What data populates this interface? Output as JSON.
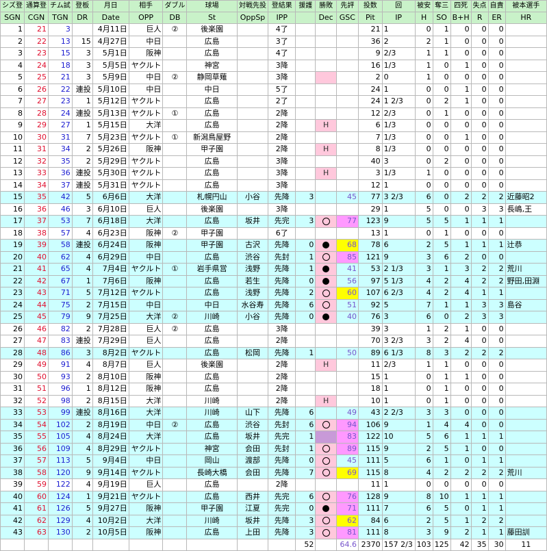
{
  "header_jp": [
    "シズ登",
    "通算登",
    "チム試",
    "登板",
    "月日",
    "相手",
    "ダブル",
    "球場",
    "対戦先投",
    "登結果",
    "援護",
    "勝敗",
    "先評",
    "投数",
    "回",
    "被安",
    "奪三",
    "四死",
    "失点",
    "自責",
    "被本選手"
  ],
  "header_en": [
    "SGN",
    "CGN",
    "TGN",
    "DR",
    "Date",
    "OPP",
    "DB",
    "St",
    "OppSp",
    "IPP",
    "",
    "Dec",
    "GSC",
    "Pit",
    "IP",
    "H",
    "SO",
    "B+H",
    "R",
    "ER",
    "HR"
  ],
  "rows": [
    {
      "sgn": "1",
      "cgn": "21",
      "tgn": "3",
      "dr": "",
      "date": "4月11日",
      "opp": "巨人",
      "db": "②",
      "st": "後楽園",
      "oppsp": "",
      "ipp": "4了",
      "run": "",
      "dec": "",
      "gsc": "",
      "pit": "21",
      "ip": "1",
      "h": "0",
      "so": "1",
      "bh": "0",
      "r": "0",
      "er": "0",
      "hr": ""
    },
    {
      "sgn": "2",
      "cgn": "22",
      "tgn": "13",
      "dr": "15",
      "date": "4月27日",
      "opp": "中日",
      "db": "",
      "st": "広島",
      "oppsp": "",
      "ipp": "3了",
      "run": "",
      "dec": "",
      "gsc": "",
      "pit": "36",
      "ip": "2",
      "h": "2",
      "so": "1",
      "bh": "0",
      "r": "0",
      "er": "0",
      "hr": ""
    },
    {
      "sgn": "3",
      "cgn": "23",
      "tgn": "15",
      "dr": "3",
      "date": "5月1日",
      "opp": "阪神",
      "db": "",
      "st": "広島",
      "oppsp": "",
      "ipp": "4了",
      "run": "",
      "dec": "",
      "gsc": "",
      "pit": "9",
      "ip": "2/3",
      "h": "1",
      "so": "1",
      "bh": "0",
      "r": "0",
      "er": "0",
      "hr": ""
    },
    {
      "sgn": "4",
      "cgn": "24",
      "tgn": "18",
      "dr": "3",
      "date": "5月5日",
      "opp": "ヤクルト",
      "db": "",
      "st": "神宮",
      "oppsp": "",
      "ipp": "3降",
      "run": "",
      "dec": "",
      "gsc": "",
      "pit": "16",
      "ip": "1/3",
      "h": "1",
      "so": "0",
      "bh": "1",
      "r": "0",
      "er": "0",
      "hr": ""
    },
    {
      "sgn": "5",
      "cgn": "25",
      "tgn": "21",
      "dr": "3",
      "date": "5月9日",
      "opp": "中日",
      "db": "②",
      "st": "静岡草薙",
      "oppsp": "",
      "ipp": "3降",
      "run": "",
      "dec": "",
      "gsc": "",
      "pit": "2",
      "ip": "0",
      "h": "1",
      "so": "0",
      "bh": "0",
      "r": "0",
      "er": "0",
      "hr": ""
    },
    {
      "sgn": "6",
      "cgn": "26",
      "tgn": "22",
      "dr": "連投",
      "date": "5月10日",
      "opp": "中日",
      "db": "",
      "st": "中日",
      "oppsp": "",
      "ipp": "5了",
      "run": "",
      "dec": "",
      "gsc": "",
      "pit": "24",
      "ip": "1",
      "h": "0",
      "so": "0",
      "bh": "1",
      "r": "0",
      "er": "0",
      "hr": ""
    },
    {
      "sgn": "7",
      "cgn": "27",
      "tgn": "23",
      "dr": "1",
      "date": "5月12日",
      "opp": "ヤクルト",
      "db": "",
      "st": "広島",
      "oppsp": "",
      "ipp": "2了",
      "run": "",
      "dec": "",
      "gsc": "",
      "pit": "24",
      "ip": "1 2/3",
      "h": "0",
      "so": "2",
      "bh": "1",
      "r": "0",
      "er": "0",
      "hr": ""
    },
    {
      "sgn": "8",
      "cgn": "28",
      "tgn": "24",
      "dr": "連投",
      "date": "5月13日",
      "opp": "ヤクルト",
      "db": "①",
      "st": "広島",
      "oppsp": "",
      "ipp": "2降",
      "run": "",
      "dec": "",
      "gsc": "",
      "pit": "12",
      "ip": "2/3",
      "h": "0",
      "so": "1",
      "bh": "0",
      "r": "0",
      "er": "0",
      "hr": ""
    },
    {
      "sgn": "9",
      "cgn": "29",
      "tgn": "27",
      "dr": "1",
      "date": "5月15日",
      "opp": "大洋",
      "db": "",
      "st": "広島",
      "oppsp": "",
      "ipp": "2降",
      "run": "",
      "dec": "H",
      "gsc": "",
      "pit": "6",
      "ip": "1/3",
      "h": "0",
      "so": "0",
      "bh": "0",
      "r": "0",
      "er": "0",
      "hr": ""
    },
    {
      "sgn": "10",
      "cgn": "30",
      "tgn": "31",
      "dr": "7",
      "date": "5月23日",
      "opp": "ヤクルト",
      "db": "①",
      "st": "新潟鳥屋野",
      "oppsp": "",
      "ipp": "2降",
      "run": "",
      "dec": "",
      "gsc": "",
      "pit": "7",
      "ip": "1/3",
      "h": "0",
      "so": "0",
      "bh": "1",
      "r": "0",
      "er": "0",
      "hr": ""
    },
    {
      "sgn": "11",
      "cgn": "31",
      "tgn": "34",
      "dr": "2",
      "date": "5月26日",
      "opp": "阪神",
      "db": "",
      "st": "甲子園",
      "oppsp": "",
      "ipp": "2降",
      "run": "",
      "dec": "H",
      "gsc": "",
      "pit": "8",
      "ip": "1/3",
      "h": "0",
      "so": "0",
      "bh": "0",
      "r": "0",
      "er": "0",
      "hr": ""
    },
    {
      "sgn": "12",
      "cgn": "32",
      "tgn": "35",
      "dr": "2",
      "date": "5月29日",
      "opp": "ヤクルト",
      "db": "",
      "st": "広島",
      "oppsp": "",
      "ipp": "3降",
      "run": "",
      "dec": "",
      "gsc": "",
      "pit": "40",
      "ip": "3",
      "h": "0",
      "so": "2",
      "bh": "0",
      "r": "0",
      "er": "0",
      "hr": ""
    },
    {
      "sgn": "13",
      "cgn": "33",
      "tgn": "36",
      "dr": "連投",
      "date": "5月30日",
      "opp": "ヤクルト",
      "db": "",
      "st": "広島",
      "oppsp": "",
      "ipp": "3降",
      "run": "",
      "dec": "H",
      "gsc": "",
      "pit": "3",
      "ip": "1/3",
      "h": "1",
      "so": "0",
      "bh": "0",
      "r": "0",
      "er": "0",
      "hr": ""
    },
    {
      "sgn": "14",
      "cgn": "34",
      "tgn": "37",
      "dr": "連投",
      "date": "5月31日",
      "opp": "ヤクルト",
      "db": "",
      "st": "広島",
      "oppsp": "",
      "ipp": "3降",
      "run": "",
      "dec": "",
      "gsc": "",
      "pit": "12",
      "ip": "1",
      "h": "0",
      "so": "0",
      "bh": "0",
      "r": "0",
      "er": "0",
      "hr": ""
    },
    {
      "sgn": "15",
      "cgn": "35",
      "tgn": "42",
      "dr": "5",
      "date": "6月6日",
      "opp": "大洋",
      "db": "",
      "st": "札幌円山",
      "oppsp": "小谷",
      "ipp": "先降",
      "run": "3",
      "dec": "",
      "gsc": "45",
      "pit": "77",
      "ip": "3 2/3",
      "h": "6",
      "so": "0",
      "bh": "2",
      "r": "2",
      "er": "2",
      "hr": "近藤昭2"
    },
    {
      "sgn": "16",
      "cgn": "36",
      "tgn": "46",
      "dr": "3",
      "date": "6月10日",
      "opp": "巨人",
      "db": "",
      "st": "後楽園",
      "oppsp": "",
      "ipp": "3降",
      "run": "",
      "dec": "",
      "gsc": "",
      "pit": "29",
      "ip": "1",
      "h": "5",
      "so": "0",
      "bh": "0",
      "r": "3",
      "er": "3",
      "hr": "長嶋,王"
    },
    {
      "sgn": "17",
      "cgn": "37",
      "tgn": "53",
      "dr": "7",
      "date": "6月18日",
      "opp": "大洋",
      "db": "",
      "st": "広島",
      "oppsp": "坂井",
      "ipp": "先完",
      "run": "3",
      "dec": "○",
      "gsc": "77",
      "pit": "123",
      "ip": "9",
      "h": "5",
      "so": "5",
      "bh": "1",
      "r": "1",
      "er": "1",
      "hr": ""
    },
    {
      "sgn": "18",
      "cgn": "38",
      "tgn": "57",
      "dr": "4",
      "date": "6月23日",
      "opp": "阪神",
      "db": "②",
      "st": "甲子園",
      "oppsp": "",
      "ipp": "6了",
      "run": "",
      "dec": "",
      "gsc": "",
      "pit": "13",
      "ip": "1",
      "h": "0",
      "so": "1",
      "bh": "0",
      "r": "0",
      "er": "0",
      "hr": ""
    },
    {
      "sgn": "19",
      "cgn": "39",
      "tgn": "58",
      "dr": "連投",
      "date": "6月24日",
      "opp": "阪神",
      "db": "",
      "st": "甲子園",
      "oppsp": "古沢",
      "ipp": "先降",
      "run": "0",
      "dec": "●",
      "gsc": "68",
      "pit": "78",
      "ip": "6",
      "h": "2",
      "so": "5",
      "bh": "1",
      "r": "1",
      "er": "1",
      "hr": "辻恭"
    },
    {
      "sgn": "20",
      "cgn": "40",
      "tgn": "62",
      "dr": "4",
      "date": "6月29日",
      "opp": "中日",
      "db": "",
      "st": "広島",
      "oppsp": "渋谷",
      "ipp": "先封",
      "run": "1",
      "dec": "○",
      "gsc": "85",
      "pit": "121",
      "ip": "9",
      "h": "3",
      "so": "6",
      "bh": "2",
      "r": "0",
      "er": "0",
      "hr": ""
    },
    {
      "sgn": "21",
      "cgn": "41",
      "tgn": "65",
      "dr": "4",
      "date": "7月4日",
      "opp": "ヤクルト",
      "db": "①",
      "st": "岩手県営",
      "oppsp": "浅野",
      "ipp": "先降",
      "run": "1",
      "dec": "●",
      "gsc": "41",
      "pit": "53",
      "ip": "2 1/3",
      "h": "3",
      "so": "1",
      "bh": "3",
      "r": "2",
      "er": "2",
      "hr": "荒川"
    },
    {
      "sgn": "22",
      "cgn": "42",
      "tgn": "67",
      "dr": "1",
      "date": "7月6日",
      "opp": "阪神",
      "db": "",
      "st": "広島",
      "oppsp": "若生",
      "ipp": "先降",
      "run": "0",
      "dec": "●",
      "gsc": "56",
      "pit": "97",
      "ip": "5 1/3",
      "h": "4",
      "so": "2",
      "bh": "4",
      "r": "2",
      "er": "2",
      "hr": "野田,田淵"
    },
    {
      "sgn": "23",
      "cgn": "43",
      "tgn": "71",
      "dr": "5",
      "date": "7月12日",
      "opp": "ヤクルト",
      "db": "",
      "st": "広島",
      "oppsp": "浅野",
      "ipp": "先降",
      "run": "2",
      "dec": "○",
      "gsc": "60",
      "pit": "107",
      "ip": "6 2/3",
      "h": "4",
      "so": "2",
      "bh": "4",
      "r": "1",
      "er": "1",
      "hr": ""
    },
    {
      "sgn": "24",
      "cgn": "44",
      "tgn": "75",
      "dr": "2",
      "date": "7月15日",
      "opp": "中日",
      "db": "",
      "st": "中日",
      "oppsp": "水谷寿",
      "ipp": "先降",
      "run": "6",
      "dec": "○",
      "gsc": "51",
      "pit": "92",
      "ip": "5",
      "h": "7",
      "so": "1",
      "bh": "1",
      "r": "3",
      "er": "3",
      "hr": "島谷"
    },
    {
      "sgn": "25",
      "cgn": "45",
      "tgn": "79",
      "dr": "9",
      "date": "7月25日",
      "opp": "大洋",
      "db": "②",
      "st": "川崎",
      "oppsp": "小谷",
      "ipp": "先降",
      "run": "0",
      "dec": "●",
      "gsc": "40",
      "pit": "76",
      "ip": "3",
      "h": "6",
      "so": "0",
      "bh": "2",
      "r": "3",
      "er": "3",
      "hr": ""
    },
    {
      "sgn": "26",
      "cgn": "46",
      "tgn": "82",
      "dr": "2",
      "date": "7月28日",
      "opp": "巨人",
      "db": "②",
      "st": "広島",
      "oppsp": "",
      "ipp": "3降",
      "run": "",
      "dec": "",
      "gsc": "",
      "pit": "39",
      "ip": "3",
      "h": "1",
      "so": "2",
      "bh": "1",
      "r": "0",
      "er": "0",
      "hr": ""
    },
    {
      "sgn": "27",
      "cgn": "47",
      "tgn": "83",
      "dr": "連投",
      "date": "7月29日",
      "opp": "巨人",
      "db": "",
      "st": "広島",
      "oppsp": "",
      "ipp": "2降",
      "run": "",
      "dec": "",
      "gsc": "",
      "pit": "70",
      "ip": "3 2/3",
      "h": "3",
      "so": "2",
      "bh": "4",
      "r": "0",
      "er": "0",
      "hr": ""
    },
    {
      "sgn": "28",
      "cgn": "48",
      "tgn": "86",
      "dr": "3",
      "date": "8月2日",
      "opp": "ヤクルト",
      "db": "",
      "st": "広島",
      "oppsp": "松岡",
      "ipp": "先降",
      "run": "1",
      "dec": "",
      "gsc": "50",
      "pit": "89",
      "ip": "6 1/3",
      "h": "8",
      "so": "3",
      "bh": "2",
      "r": "2",
      "er": "2",
      "hr": ""
    },
    {
      "sgn": "29",
      "cgn": "49",
      "tgn": "91",
      "dr": "4",
      "date": "8月7日",
      "opp": "巨人",
      "db": "",
      "st": "後楽園",
      "oppsp": "",
      "ipp": "2降",
      "run": "",
      "dec": "H",
      "gsc": "",
      "pit": "11",
      "ip": "2/3",
      "h": "1",
      "so": "1",
      "bh": "0",
      "r": "0",
      "er": "0",
      "hr": ""
    },
    {
      "sgn": "30",
      "cgn": "50",
      "tgn": "93",
      "dr": "2",
      "date": "8月10日",
      "opp": "阪神",
      "db": "",
      "st": "広島",
      "oppsp": "",
      "ipp": "2降",
      "run": "",
      "dec": "",
      "gsc": "",
      "pit": "15",
      "ip": "1",
      "h": "0",
      "so": "1",
      "bh": "1",
      "r": "0",
      "er": "0",
      "hr": ""
    },
    {
      "sgn": "31",
      "cgn": "51",
      "tgn": "96",
      "dr": "1",
      "date": "8月12日",
      "opp": "阪神",
      "db": "",
      "st": "広島",
      "oppsp": "",
      "ipp": "2降",
      "run": "",
      "dec": "",
      "gsc": "",
      "pit": "18",
      "ip": "1",
      "h": "0",
      "so": "1",
      "bh": "0",
      "r": "0",
      "er": "0",
      "hr": ""
    },
    {
      "sgn": "32",
      "cgn": "52",
      "tgn": "98",
      "dr": "2",
      "date": "8月15日",
      "opp": "大洋",
      "db": "",
      "st": "川崎",
      "oppsp": "",
      "ipp": "2降",
      "run": "",
      "dec": "H",
      "gsc": "",
      "pit": "10",
      "ip": "1",
      "h": "0",
      "so": "1",
      "bh": "0",
      "r": "0",
      "er": "0",
      "hr": ""
    },
    {
      "sgn": "33",
      "cgn": "53",
      "tgn": "99",
      "dr": "連投",
      "date": "8月16日",
      "opp": "大洋",
      "db": "",
      "st": "川崎",
      "oppsp": "山下",
      "ipp": "先降",
      "run": "6",
      "dec": "",
      "gsc": "49",
      "pit": "43",
      "ip": "2 2/3",
      "h": "3",
      "so": "3",
      "bh": "0",
      "r": "0",
      "er": "0",
      "hr": ""
    },
    {
      "sgn": "34",
      "cgn": "54",
      "tgn": "102",
      "dr": "2",
      "date": "8月19日",
      "opp": "中日",
      "db": "②",
      "st": "広島",
      "oppsp": "渋谷",
      "ipp": "先封",
      "run": "6",
      "dec": "○",
      "gsc": "94",
      "pit": "106",
      "ip": "9",
      "h": "1",
      "so": "4",
      "bh": "4",
      "r": "0",
      "er": "0",
      "hr": ""
    },
    {
      "sgn": "35",
      "cgn": "55",
      "tgn": "105",
      "dr": "4",
      "date": "8月24日",
      "opp": "大洋",
      "db": "",
      "st": "広島",
      "oppsp": "坂井",
      "ipp": "先完",
      "run": "1",
      "dec": "",
      "gsc": "83",
      "pit": "122",
      "ip": "10",
      "h": "5",
      "so": "6",
      "bh": "1",
      "r": "1",
      "er": "1",
      "hr": ""
    },
    {
      "sgn": "36",
      "cgn": "56",
      "tgn": "109",
      "dr": "4",
      "date": "8月29日",
      "opp": "ヤクルト",
      "db": "",
      "st": "神宮",
      "oppsp": "会田",
      "ipp": "先封",
      "run": "1",
      "dec": "○",
      "gsc": "89",
      "pit": "115",
      "ip": "9",
      "h": "2",
      "so": "5",
      "bh": "1",
      "r": "0",
      "er": "0",
      "hr": ""
    },
    {
      "sgn": "37",
      "cgn": "57",
      "tgn": "113",
      "dr": "5",
      "date": "9月4日",
      "opp": "中日",
      "db": "",
      "st": "岡山",
      "oppsp": "渡部",
      "ipp": "先降",
      "run": "0",
      "dec": "○",
      "gsc": "45",
      "pit": "111",
      "ip": "5",
      "h": "6",
      "so": "1",
      "bh": "0",
      "r": "1",
      "er": "1",
      "hr": ""
    },
    {
      "sgn": "38",
      "cgn": "58",
      "tgn": "120",
      "dr": "9",
      "date": "9月14日",
      "opp": "ヤクルト",
      "db": "",
      "st": "長崎大橋",
      "oppsp": "会田",
      "ipp": "先降",
      "run": "7",
      "dec": "○",
      "gsc": "69",
      "pit": "115",
      "ip": "8",
      "h": "4",
      "so": "2",
      "bh": "2",
      "r": "2",
      "er": "2",
      "hr": "荒川"
    },
    {
      "sgn": "39",
      "cgn": "59",
      "tgn": "122",
      "dr": "4",
      "date": "9月19日",
      "opp": "巨人",
      "db": "",
      "st": "広島",
      "oppsp": "",
      "ipp": "2降",
      "run": "",
      "dec": "",
      "gsc": "",
      "pit": "11",
      "ip": "1",
      "h": "0",
      "so": "0",
      "bh": "0",
      "r": "0",
      "er": "0",
      "hr": ""
    },
    {
      "sgn": "40",
      "cgn": "60",
      "tgn": "124",
      "dr": "1",
      "date": "9月21日",
      "opp": "ヤクルト",
      "db": "",
      "st": "広島",
      "oppsp": "西井",
      "ipp": "先完",
      "run": "6",
      "dec": "○",
      "gsc": "76",
      "pit": "128",
      "ip": "9",
      "h": "8",
      "so": "10",
      "bh": "1",
      "r": "1",
      "er": "1",
      "hr": ""
    },
    {
      "sgn": "41",
      "cgn": "61",
      "tgn": "126",
      "dr": "5",
      "date": "9月27日",
      "opp": "阪神",
      "db": "",
      "st": "甲子園",
      "oppsp": "江夏",
      "ipp": "先完",
      "run": "0",
      "dec": "●",
      "gsc": "71",
      "pit": "111",
      "ip": "7",
      "h": "6",
      "so": "5",
      "bh": "0",
      "r": "1",
      "er": "1",
      "hr": ""
    },
    {
      "sgn": "42",
      "cgn": "62",
      "tgn": "129",
      "dr": "4",
      "date": "10月2日",
      "opp": "大洋",
      "db": "",
      "st": "川崎",
      "oppsp": "坂井",
      "ipp": "先降",
      "run": "3",
      "dec": "○",
      "gsc": "62",
      "pit": "84",
      "ip": "6",
      "h": "2",
      "so": "5",
      "bh": "1",
      "r": "2",
      "er": "2",
      "hr": ""
    },
    {
      "sgn": "43",
      "cgn": "63",
      "tgn": "130",
      "dr": "2",
      "date": "10月5日",
      "opp": "阪神",
      "db": "",
      "st": "広島",
      "oppsp": "上田",
      "ipp": "先降",
      "run": "3",
      "dec": "○",
      "gsc": "81",
      "pit": "111",
      "ip": "8",
      "h": "3",
      "so": "9",
      "bh": "2",
      "r": "1",
      "er": "1",
      "hr": "藤田訓"
    }
  ],
  "footer": {
    "run": "52",
    "gsc": "64.6",
    "pit": "2370",
    "ip": "157 2/3",
    "h": "103",
    "so": "125",
    "bh": "42",
    "r": "35",
    "er": "30",
    "hr": "11"
  }
}
